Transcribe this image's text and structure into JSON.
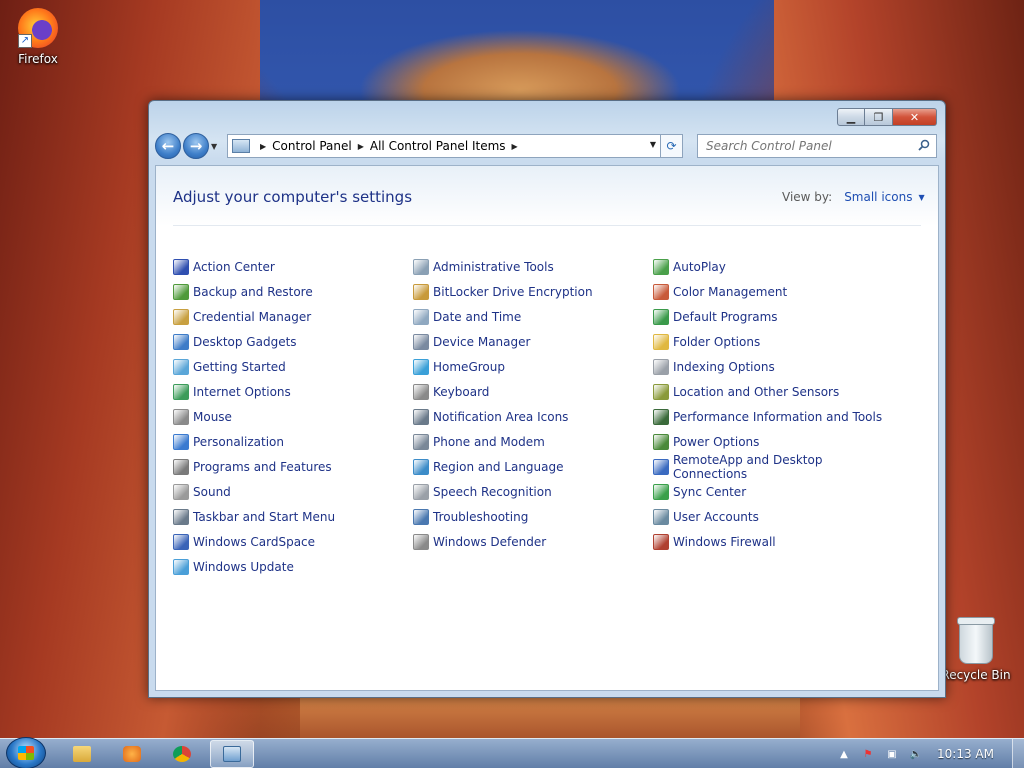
{
  "desktop": {
    "icons": [
      {
        "label": "Firefox"
      },
      {
        "label": "Recycle Bin"
      }
    ]
  },
  "window": {
    "address": {
      "crumbs": [
        "Control Panel",
        "All Control Panel Items"
      ]
    },
    "search": {
      "placeholder": "Search Control Panel"
    },
    "heading": "Adjust your computer's settings",
    "view_by": {
      "label": "View by:",
      "value": "Small icons"
    },
    "columns": [
      [
        {
          "label": "Action Center",
          "color": "#2f4fb0"
        },
        {
          "label": "Backup and Restore",
          "color": "#4f9a3a"
        },
        {
          "label": "Credential Manager",
          "color": "#c8a040"
        },
        {
          "label": "Desktop Gadgets",
          "color": "#3e7cc8"
        },
        {
          "label": "Getting Started",
          "color": "#5aa6d8"
        },
        {
          "label": "Internet Options",
          "color": "#3c9c5a"
        },
        {
          "label": "Mouse",
          "color": "#8a8a8a"
        },
        {
          "label": "Personalization",
          "color": "#3a7ad0"
        },
        {
          "label": "Programs and Features",
          "color": "#7a7a7a"
        },
        {
          "label": "Sound",
          "color": "#9a9a9a"
        },
        {
          "label": "Taskbar and Start Menu",
          "color": "#6a7a8a"
        },
        {
          "label": "Windows CardSpace",
          "color": "#3a64b8"
        },
        {
          "label": "Windows Update",
          "color": "#4a9fd8"
        }
      ],
      [
        {
          "label": "Administrative Tools",
          "color": "#8aa0b4"
        },
        {
          "label": "BitLocker Drive Encryption",
          "color": "#c89a3a"
        },
        {
          "label": "Date and Time",
          "color": "#8fa8c0"
        },
        {
          "label": "Device Manager",
          "color": "#7a8aa0"
        },
        {
          "label": "HomeGroup",
          "color": "#3aa0d8"
        },
        {
          "label": "Keyboard",
          "color": "#8a8a8a"
        },
        {
          "label": "Notification Area Icons",
          "color": "#6a7a8a"
        },
        {
          "label": "Phone and Modem",
          "color": "#7a8898"
        },
        {
          "label": "Region and Language",
          "color": "#3c8cc8"
        },
        {
          "label": "Speech Recognition",
          "color": "#9aa0a8"
        },
        {
          "label": "Troubleshooting",
          "color": "#4a78b0"
        },
        {
          "label": "Windows Defender",
          "color": "#8a8a8a"
        }
      ],
      [
        {
          "label": "AutoPlay",
          "color": "#4aa04a"
        },
        {
          "label": "Color Management",
          "color": "#c85a3a"
        },
        {
          "label": "Default Programs",
          "color": "#3a9a4a"
        },
        {
          "label": "Folder Options",
          "color": "#e0b840"
        },
        {
          "label": "Indexing Options",
          "color": "#9aa0a8"
        },
        {
          "label": "Location and Other Sensors",
          "color": "#8a9a3a"
        },
        {
          "label": "Performance Information and Tools",
          "color": "#3a6a3a"
        },
        {
          "label": "Power Options",
          "color": "#4a8a3a"
        },
        {
          "label": "RemoteApp and Desktop Connections",
          "color": "#3a6ac0"
        },
        {
          "label": "Sync Center",
          "color": "#3aa04a"
        },
        {
          "label": "User Accounts",
          "color": "#6a8aa0"
        },
        {
          "label": "Windows Firewall",
          "color": "#b04030"
        }
      ]
    ]
  },
  "taskbar": {
    "clock": "10:13 AM"
  }
}
